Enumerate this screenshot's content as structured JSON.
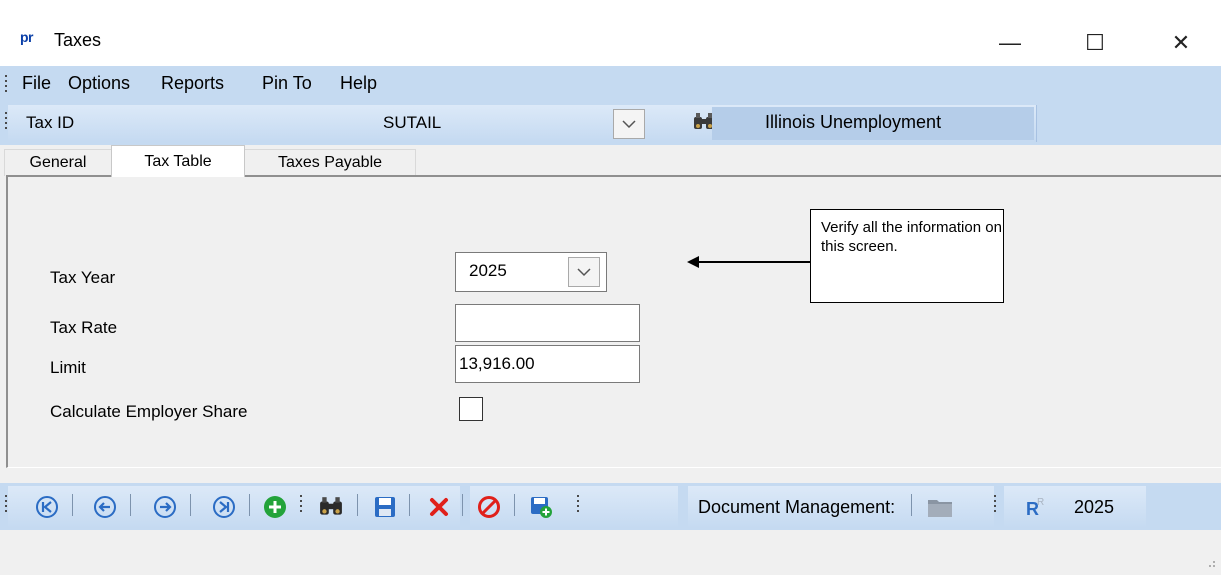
{
  "app": {
    "logo_text": "pr",
    "title": "Taxes",
    "controls": {
      "minimize": "—",
      "maximize": "☐",
      "close": "✕"
    }
  },
  "menu": {
    "items": [
      {
        "label": "File"
      },
      {
        "label": "Options"
      },
      {
        "label": "Reports"
      },
      {
        "label": "Pin To"
      },
      {
        "label": "Help"
      }
    ]
  },
  "taxbar": {
    "label": "Tax ID",
    "value": "SUTAIL",
    "description": "Illinois Unemployment"
  },
  "tabs": [
    {
      "label": "General",
      "active": false
    },
    {
      "label": "Tax Table",
      "active": true
    },
    {
      "label": "Taxes Payable",
      "active": false
    }
  ],
  "form": {
    "tax_year": {
      "label": "Tax Year",
      "value": "2025"
    },
    "tax_rate": {
      "label": "Tax Rate",
      "value": ""
    },
    "limit": {
      "label": "Limit",
      "value": "13,916.00"
    },
    "employer_share": {
      "label": "Calculate Employer Share",
      "checked": false
    }
  },
  "annotation": {
    "text": "Verify all the information on this screen."
  },
  "toolbar": {
    "document_management": "Document Management:",
    "year": "2025"
  },
  "colors": {
    "accent_bar": "#c5daf1",
    "desc_panel": "#b5cde9",
    "nav_blue": "#2b6cc4",
    "add_green": "#23a33a",
    "delete_red": "#e0201a"
  }
}
